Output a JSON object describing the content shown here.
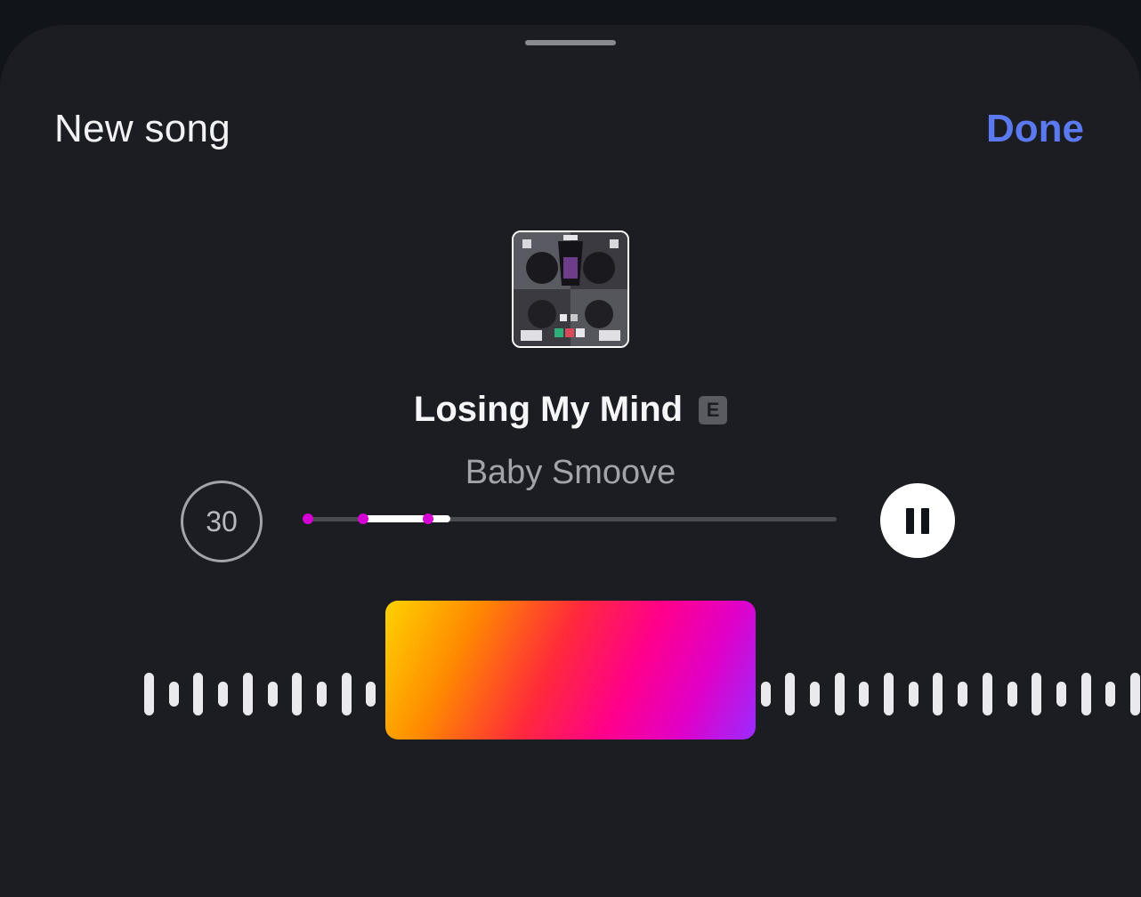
{
  "header": {
    "title": "New song",
    "done_label": "Done"
  },
  "track": {
    "title": "Losing My Mind",
    "explicit_badge": "E",
    "artist": "Baby Smoove"
  },
  "playback": {
    "clip_duration": "30",
    "state": "playing",
    "clip_start_fraction": 0.105,
    "clip_end_fraction": 0.27
  },
  "colors": {
    "accent": "#5b79f0",
    "marker": "#d400d4",
    "background": "#1c1d22"
  },
  "icons": {
    "pause": "pause-icon",
    "album_art": "album-art"
  }
}
